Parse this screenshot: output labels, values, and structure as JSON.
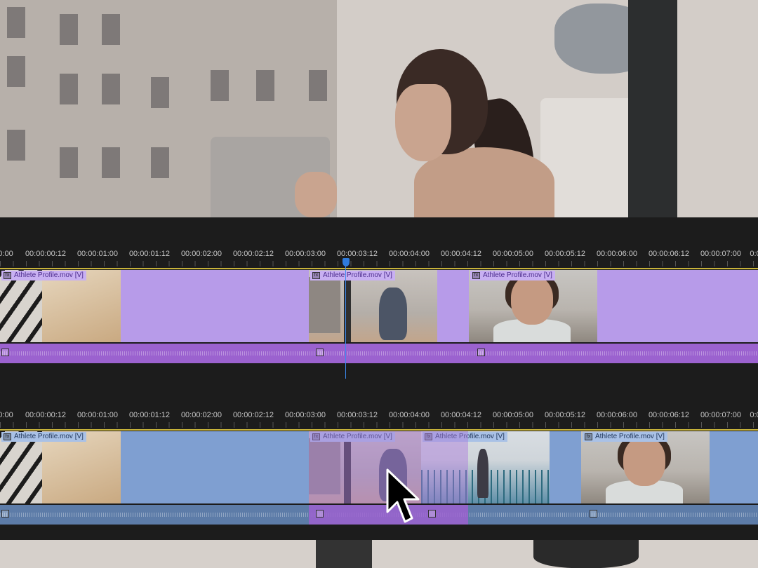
{
  "ruler": {
    "labels": [
      "0:00",
      "00:00:00:12",
      "00:00:01:00",
      "00:00:01:12",
      "00:00:02:00",
      "00:00:02:12",
      "00:00:03:00",
      "00:00:03:12",
      "00:00:04:00",
      "00:00:04:12",
      "00:00:05:00",
      "00:00:05:12",
      "00:00:06:00",
      "00:00:06:12",
      "00:00:07:00",
      "0:0"
    ]
  },
  "top_timeline": {
    "clips": [
      {
        "label": "Athlete Profile.mov [V]",
        "thumb": "gym-runner"
      },
      {
        "label": "Athlete Profile.mov [V]",
        "thumb": "rooftop-runner"
      },
      {
        "label": "Athlete Profile.mov [V]",
        "thumb": "portrait"
      }
    ],
    "colors": {
      "video": "#b79be9",
      "audio": "#9b62cf"
    }
  },
  "bottom_timeline": {
    "clips": [
      {
        "label": "Athlete Profile.mov [V]",
        "thumb": "gym-runner"
      },
      {
        "label": "Athlete Profile.mov [V]",
        "thumb": "rooftop-runner"
      },
      {
        "label": "Athlete Profile.mov [V]",
        "thumb": "bridge-runner"
      },
      {
        "label": "Athlete Profile.mov [V]",
        "thumb": "portrait"
      }
    ],
    "colors": {
      "video": "#7f9fd1",
      "audio": "#5d7ca8"
    }
  },
  "playhead_color": "#2f7bdc",
  "icons": [
    "fx-icon",
    "playhead-icon",
    "mouse-pointer-icon"
  ]
}
